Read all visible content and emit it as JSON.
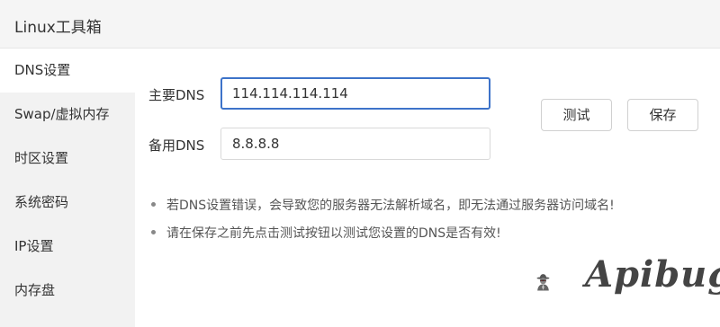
{
  "window": {
    "title": "Linux工具箱"
  },
  "sidebar": {
    "items": [
      {
        "label": "DNS设置",
        "active": true
      },
      {
        "label": "Swap/虚拟内存",
        "active": false
      },
      {
        "label": "时区设置",
        "active": false
      },
      {
        "label": "系统密码",
        "active": false
      },
      {
        "label": "IP设置",
        "active": false
      },
      {
        "label": "内存盘",
        "active": false
      }
    ]
  },
  "dns_form": {
    "primary_label": "主要DNS",
    "primary_value": "114.114.114.114",
    "secondary_label": "备用DNS",
    "secondary_value": "8.8.8.8",
    "test_button": "测试",
    "save_button": "保存"
  },
  "notes": [
    "若DNS设置错误，会导致您的服务器无法解析域名，即无法通过服务器访问域名!",
    "请在保存之前先点击测试按钮以测试您设置的DNS是否有效!"
  ],
  "watermark": {
    "text": "Apibug"
  },
  "colors": {
    "accent": "#3d73c9",
    "sidebar_bg": "#f2f2f2"
  }
}
